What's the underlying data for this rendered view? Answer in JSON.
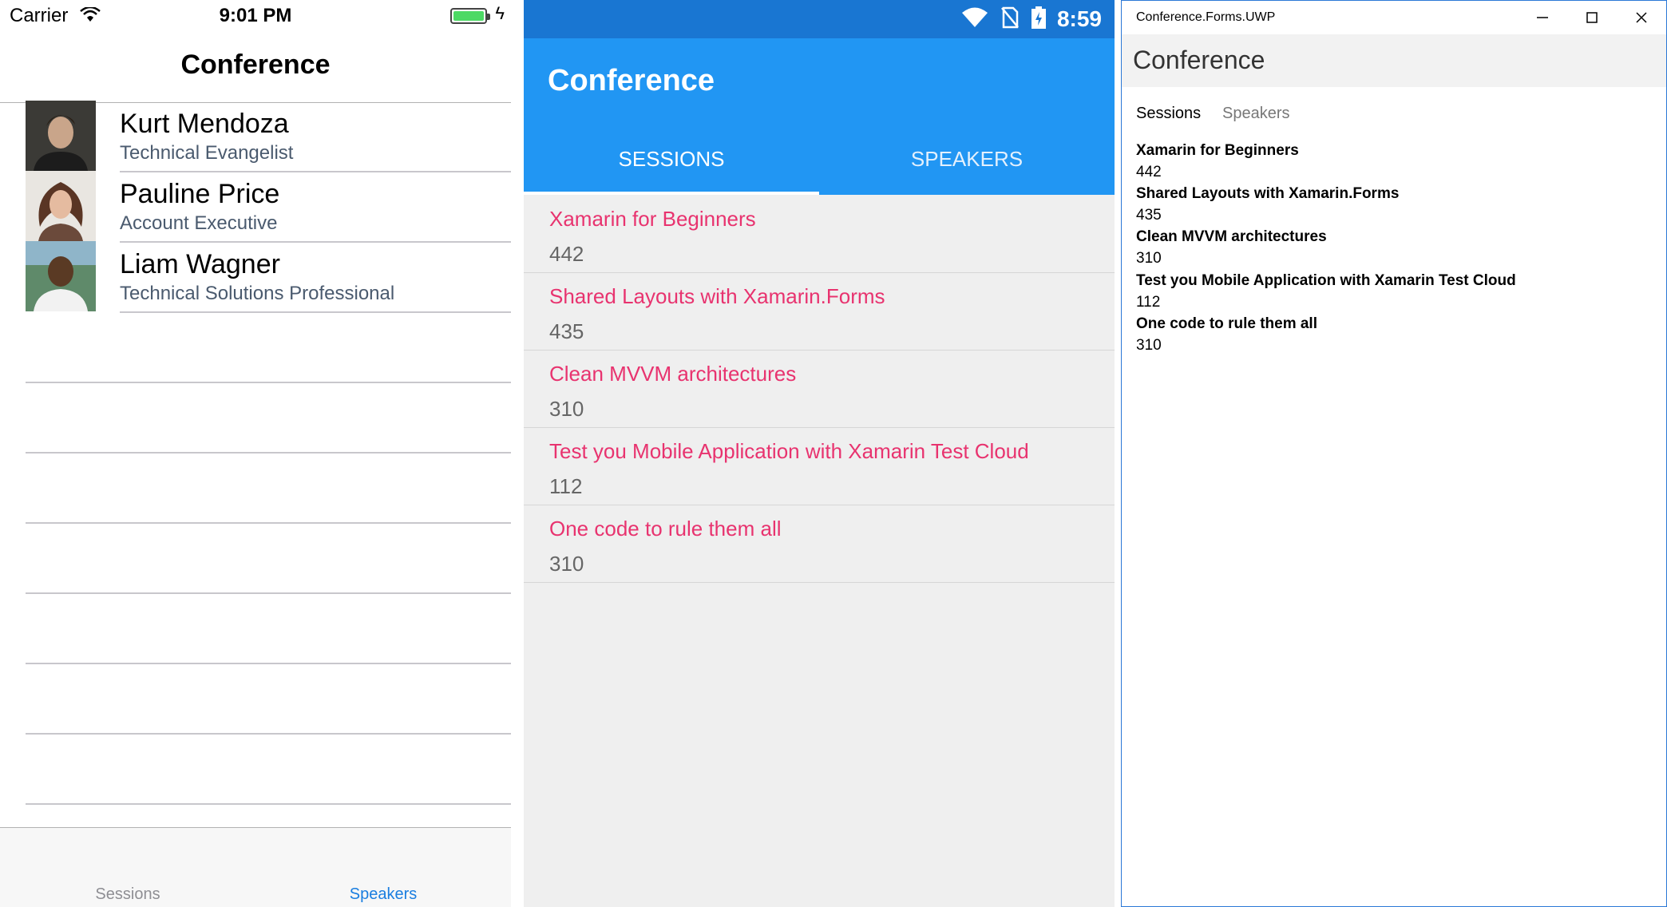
{
  "ios": {
    "status": {
      "carrier": "Carrier",
      "time": "9:01 PM",
      "wifi_icon": "wifi-icon",
      "battery_icon": "battery-icon",
      "charging_icon": "bolt-icon"
    },
    "nav_title": "Conference",
    "speakers": [
      {
        "name": "Kurt Mendoza",
        "title": "Technical Evangelist",
        "avatar": "avatar-photo"
      },
      {
        "name": "Pauline Price",
        "title": "Account Executive",
        "avatar": "avatar-photo"
      },
      {
        "name": "Liam Wagner",
        "title": "Technical Solutions Professional",
        "avatar": "avatar-photo"
      }
    ],
    "tabs": {
      "sessions": "Sessions",
      "speakers": "Speakers",
      "selected": "Speakers"
    },
    "colors": {
      "accent": "#1a7ee0",
      "subtitle": "#4a5a6e"
    }
  },
  "android": {
    "status": {
      "time": "8:59",
      "icons": [
        "wifi-icon",
        "no-sim-icon",
        "battery-icon"
      ]
    },
    "app_title": "Conference",
    "tabs": {
      "sessions": "SESSIONS",
      "speakers": "SPEAKERS",
      "selected": "SESSIONS"
    },
    "sessions": [
      {
        "title": "Xamarin for Beginners",
        "detail": "442"
      },
      {
        "title": "Shared Layouts with Xamarin.Forms",
        "detail": "435"
      },
      {
        "title": "Clean MVVM architectures",
        "detail": "310"
      },
      {
        "title": "Test you Mobile Application with Xamarin Test Cloud",
        "detail": "112"
      },
      {
        "title": "One code to rule them all",
        "detail": "310"
      }
    ],
    "colors": {
      "primary": "#2196f3",
      "primary_dark": "#1976d2",
      "accent": "#e8336f",
      "background": "#efefef"
    }
  },
  "uwp": {
    "window_title": "Conference.Forms.UWP",
    "window_buttons": [
      "minimize-icon",
      "maximize-icon",
      "close-icon"
    ],
    "page_title": "Conference",
    "tabs": {
      "sessions": "Sessions",
      "speakers": "Speakers",
      "selected": "Sessions"
    },
    "sessions": [
      {
        "title": "Xamarin for Beginners",
        "detail": "442"
      },
      {
        "title": "Shared Layouts with Xamarin.Forms",
        "detail": "435"
      },
      {
        "title": "Clean MVVM architectures",
        "detail": "310"
      },
      {
        "title": "Test you Mobile Application with Xamarin Test Cloud",
        "detail": "112"
      },
      {
        "title": "One code to rule them all",
        "detail": "310"
      }
    ],
    "colors": {
      "header_bg": "#f2f2f2",
      "window_border": "#2b78d6"
    }
  }
}
